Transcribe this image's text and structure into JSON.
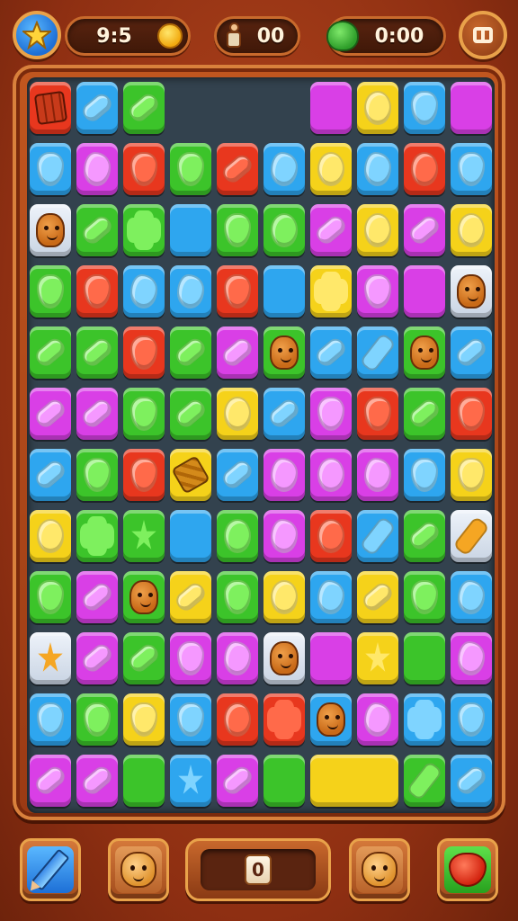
{
  "hud": {
    "score": "9:5",
    "character_count": "00",
    "timer": "0:00",
    "icons": {
      "level": "star-icon",
      "currency": "coin-icon",
      "character": "character-icon",
      "timer": "slime-icon",
      "menu": "pause-icon"
    }
  },
  "palette": {
    "red": "#e8371e",
    "orange": "#f08a1a",
    "yellow": "#f5d21a",
    "green": "#3cc42a",
    "blue": "#2ea6ef",
    "magenta": "#d93fe6",
    "cream": "#dfe7f2",
    "board": "#33424e"
  },
  "board": {
    "cols": 10,
    "rows": 12,
    "rows_data": [
      [
        [
          "red",
          "crate"
        ],
        [
          "blue",
          "bar"
        ],
        [
          "green",
          "bar"
        ],
        null,
        null,
        null,
        [
          "magenta",
          "none"
        ],
        [
          "yellow",
          "circle"
        ],
        [
          "blue",
          "heart"
        ],
        [
          "magenta",
          "none"
        ]
      ],
      [
        [
          "blue",
          "heart"
        ],
        [
          "magenta",
          "blob"
        ],
        [
          "red",
          "heart"
        ],
        [
          "green",
          "heart"
        ],
        [
          "red",
          "bar"
        ],
        [
          "blue",
          "blob"
        ],
        [
          "yellow",
          "circle"
        ],
        [
          "blue",
          "blob"
        ],
        [
          "red",
          "circle"
        ],
        [
          "blue",
          "heart"
        ]
      ],
      [
        [
          "cream",
          "critter"
        ],
        [
          "green",
          "bar"
        ],
        [
          "green",
          "flower"
        ],
        [
          "blue",
          "none"
        ],
        [
          "green",
          "heart"
        ],
        [
          "green",
          "circle"
        ],
        [
          "magenta",
          "bar"
        ],
        [
          "yellow",
          "circle"
        ],
        [
          "magenta",
          "bar"
        ],
        [
          "yellow",
          "circle"
        ]
      ],
      [
        [
          "green",
          "heart"
        ],
        [
          "red",
          "heart"
        ],
        [
          "blue",
          "blob"
        ],
        [
          "blue",
          "blob"
        ],
        [
          "red",
          "heart"
        ],
        [
          "blue",
          "none"
        ],
        [
          "yellow",
          "flower"
        ],
        [
          "magenta",
          "heart"
        ],
        [
          "magenta",
          "none"
        ],
        [
          "cream",
          "critter"
        ]
      ],
      [
        [
          "green",
          "bar"
        ],
        [
          "green",
          "bar"
        ],
        [
          "red",
          "heart"
        ],
        [
          "green",
          "bar"
        ],
        [
          "magenta",
          "bar"
        ],
        [
          "green",
          "critter"
        ],
        [
          "blue",
          "bar"
        ],
        [
          "blue",
          "bottle"
        ],
        [
          "green",
          "critter"
        ],
        [
          "blue",
          "bar"
        ]
      ],
      [
        [
          "magenta",
          "bar"
        ],
        [
          "magenta",
          "bar"
        ],
        [
          "green",
          "heart"
        ],
        [
          "green",
          "bar"
        ],
        [
          "yellow",
          "circle"
        ],
        [
          "blue",
          "bar"
        ],
        [
          "magenta",
          "heart"
        ],
        [
          "red",
          "heart"
        ],
        [
          "green",
          "bar"
        ],
        [
          "red",
          "heart"
        ]
      ],
      [
        [
          "blue",
          "bar"
        ],
        [
          "green",
          "heart"
        ],
        [
          "red",
          "heart"
        ],
        [
          "yellow",
          "wrap"
        ],
        [
          "blue",
          "bar"
        ],
        [
          "magenta",
          "blob"
        ],
        [
          "magenta",
          "circle"
        ],
        [
          "magenta",
          "blob"
        ],
        [
          "blue",
          "heart"
        ],
        [
          "yellow",
          "heart"
        ]
      ],
      [
        [
          "yellow",
          "circle"
        ],
        [
          "green",
          "flower"
        ],
        [
          "green",
          "star"
        ],
        [
          "blue",
          "none"
        ],
        [
          "green",
          "circle"
        ],
        [
          "magenta",
          "blob"
        ],
        [
          "red",
          "circle"
        ],
        [
          "blue",
          "bottle"
        ],
        [
          "green",
          "bar"
        ],
        [
          "cream",
          "bottle"
        ]
      ],
      [
        [
          "green",
          "heart"
        ],
        [
          "magenta",
          "bar"
        ],
        [
          "green",
          "critter"
        ],
        [
          "yellow",
          "bar"
        ],
        [
          "green",
          "heart"
        ],
        [
          "yellow",
          "circle"
        ],
        [
          "blue",
          "blob"
        ],
        [
          "yellow",
          "bar"
        ],
        [
          "green",
          "heart"
        ],
        [
          "blue",
          "blob"
        ]
      ],
      [
        [
          "cream",
          "star"
        ],
        [
          "magenta",
          "bar"
        ],
        [
          "green",
          "bar"
        ],
        [
          "magenta",
          "heart"
        ],
        [
          "magenta",
          "blob"
        ],
        [
          "cream",
          "critter"
        ],
        [
          "magenta",
          "none"
        ],
        [
          "yellow",
          "star"
        ],
        [
          "green",
          "none"
        ],
        [
          "magenta",
          "blob"
        ]
      ],
      [
        [
          "blue",
          "heart"
        ],
        [
          "green",
          "heart"
        ],
        [
          "yellow",
          "heart"
        ],
        [
          "blue",
          "heart"
        ],
        [
          "red",
          "circle"
        ],
        [
          "red",
          "flower"
        ],
        [
          "blue",
          "critter"
        ],
        [
          "magenta",
          "blob"
        ],
        [
          "blue",
          "flower"
        ],
        [
          "blue",
          "heart"
        ]
      ],
      [
        [
          "magenta",
          "bar"
        ],
        [
          "magenta",
          "bar"
        ],
        [
          "green",
          "none"
        ],
        [
          "blue",
          "star"
        ],
        [
          "magenta",
          "bar"
        ],
        [
          "green",
          "none"
        ],
        [
          "yellow",
          "wide"
        ],
        null,
        [
          "green",
          "bottle"
        ],
        [
          "blue",
          "bar"
        ]
      ]
    ]
  },
  "bottom_bar": {
    "slot_value": "0",
    "icons": {
      "left": "pencil-icon",
      "left2": "critter-face-icon",
      "right2": "critter-face-icon",
      "right": "heart-icon"
    }
  }
}
